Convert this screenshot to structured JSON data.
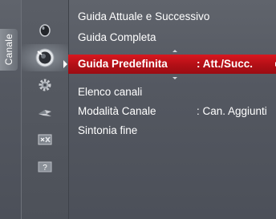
{
  "category_tab": {
    "label": "Canale"
  },
  "icons": [
    {
      "name": "picture-icon",
      "active": false
    },
    {
      "name": "channel-satellite-icon",
      "active": true
    },
    {
      "name": "setup-gear-icon",
      "active": false
    },
    {
      "name": "input-icon",
      "active": false
    },
    {
      "name": "application-icon",
      "active": false
    },
    {
      "name": "support-icon",
      "active": false,
      "glyph": "?"
    }
  ],
  "menu": {
    "items": [
      {
        "label": "Guida Attuale e Successivo",
        "value": ""
      },
      {
        "label": "Guida Completa",
        "value": ""
      },
      {
        "label": "Guida Predefinita",
        "value": ": Att./Succ.",
        "selected": true
      },
      {
        "label": "Elenco canali",
        "value": ""
      },
      {
        "label": "Modalità Canale",
        "value": ": Can. Aggiunti"
      },
      {
        "label": "Sintonia fine",
        "value": ""
      }
    ]
  },
  "colors": {
    "selection": "#c8121a",
    "background": "#555961",
    "text": "#ffffff"
  }
}
